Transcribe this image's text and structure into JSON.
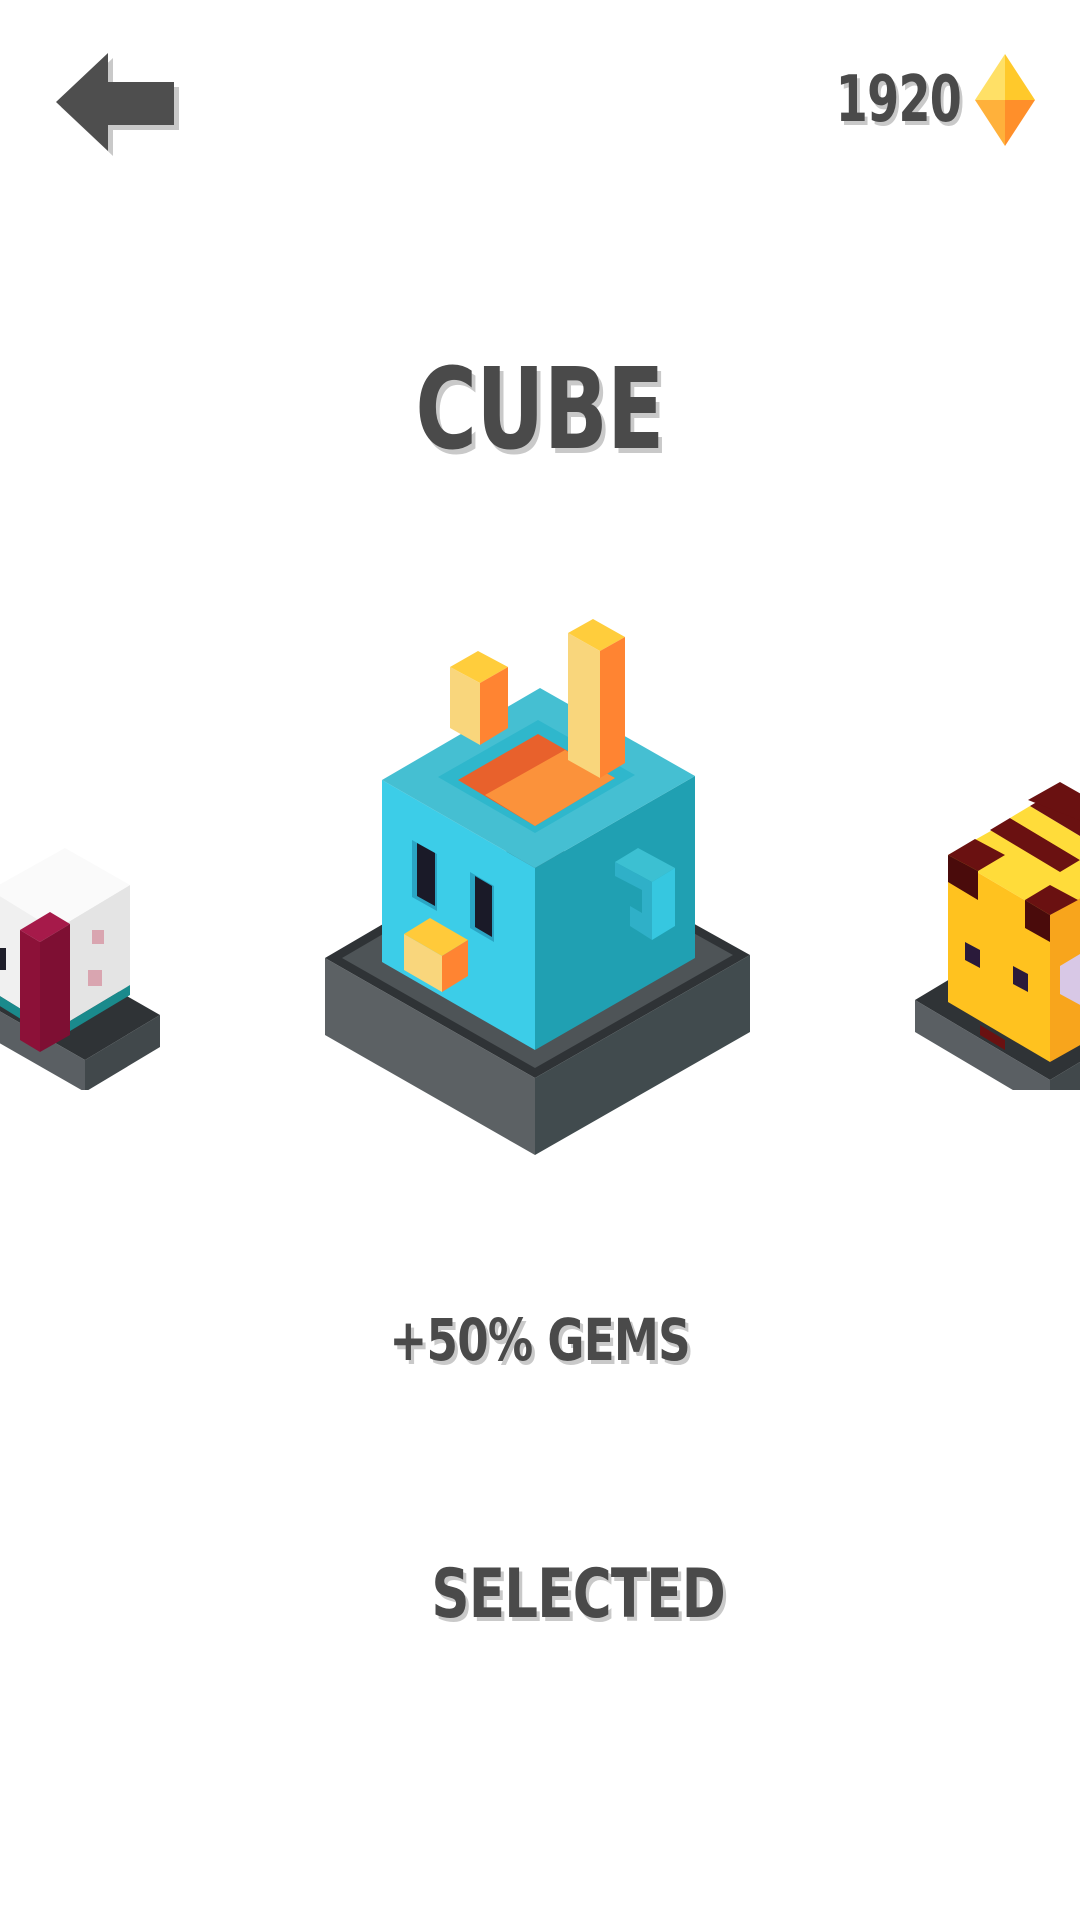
{
  "header": {
    "back_icon": "back-arrow-icon",
    "gem_count": "1920",
    "gem_icon": "gem-icon"
  },
  "character": {
    "name": "CUBE",
    "bonus": "+50% GEMS",
    "status": "SELECTED"
  },
  "colors": {
    "text": "#4a4a4a",
    "text_shadow": "#c9c9c9",
    "cube_blue": "#3ccde8",
    "pedestal": "#5a5f63",
    "gem_yellow": "#ffd43b",
    "gem_orange": "#ff9a2e"
  }
}
